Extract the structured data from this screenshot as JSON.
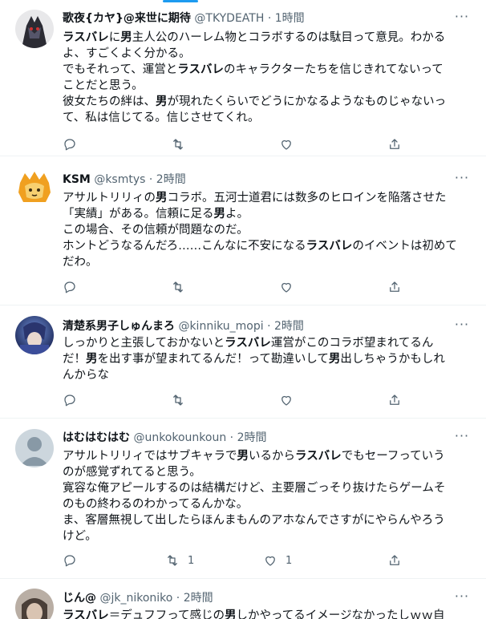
{
  "tweets": [
    {
      "name": "歌夜{カヤ}@来世に期待",
      "handle": "@TKYDEATH",
      "time": "1時間",
      "lines": [
        [
          {
            "t": "ラスバレ",
            "b": true
          },
          {
            "t": "に"
          },
          {
            "t": "男",
            "b": true
          },
          {
            "t": "主人公のハーレム物とコラボするのは駄目って意見。わかる"
          }
        ],
        [
          {
            "t": "よ、すごくよく分かる。"
          }
        ],
        [
          {
            "t": "でもそれって、運営と"
          },
          {
            "t": "ラスバレ",
            "b": true
          },
          {
            "t": "のキャラクターたちを信じきれてないって"
          }
        ],
        [
          {
            "t": "ことだと思う。"
          }
        ],
        [
          {
            "t": "彼女たちの絆は、"
          },
          {
            "t": "男",
            "b": true
          },
          {
            "t": "が現れたくらいでどうにかなるようなものじゃないっ"
          }
        ],
        [
          {
            "t": "て、私は信じてる。信じさせてくれ。"
          }
        ]
      ],
      "reply": "",
      "retweet": "",
      "like": ""
    },
    {
      "name": "KSM",
      "handle": "@ksmtys",
      "time": "2時間",
      "lines": [
        [
          {
            "t": "アサルトリリィの"
          },
          {
            "t": "男",
            "b": true
          },
          {
            "t": "コラボ。五河士道君には数多のヒロインを陥落させた"
          }
        ],
        [
          {
            "t": "「実績」がある。信頼に足る"
          },
          {
            "t": "男",
            "b": true
          },
          {
            "t": "よ。"
          }
        ],
        [
          {
            "t": "この場合、その信頼が問題なのだ。"
          }
        ],
        [
          {
            "t": "ホントどうなるんだろ……こんなに不安になる"
          },
          {
            "t": "ラスバレ",
            "b": true
          },
          {
            "t": "のイベントは初めて"
          }
        ],
        [
          {
            "t": "だわ。"
          }
        ]
      ],
      "reply": "",
      "retweet": "",
      "like": ""
    },
    {
      "name": "清楚系男子しゅんまろ",
      "handle": "@kinniku_mopi",
      "time": "2時間",
      "lines": [
        [
          {
            "t": "しっかりと主張しておかないと"
          },
          {
            "t": "ラスバレ",
            "b": true
          },
          {
            "t": "運営がこのコラボ望まれてるん"
          }
        ],
        [
          {
            "t": "だ！"
          },
          {
            "t": "男",
            "b": true
          },
          {
            "t": "を出す事が望まれてるんだ！って勘違いして"
          },
          {
            "t": "男",
            "b": true
          },
          {
            "t": "出しちゃうかもしれ"
          }
        ],
        [
          {
            "t": "んからな"
          }
        ]
      ],
      "reply": "",
      "retweet": "",
      "like": ""
    },
    {
      "name": "はむはむはむ",
      "handle": "@unkokounkoun",
      "time": "2時間",
      "lines": [
        [
          {
            "t": "アサルトリリィではサブキャラで"
          },
          {
            "t": "男",
            "b": true
          },
          {
            "t": "いるから"
          },
          {
            "t": "ラスバレ",
            "b": true
          },
          {
            "t": "でもセーフっていう"
          }
        ],
        [
          {
            "t": "のが感覚ずれてると思う。"
          }
        ],
        [
          {
            "t": "寛容な俺アピールするのは結構だけど、主要層ごっそり抜けたらゲームそ"
          }
        ],
        [
          {
            "t": "のもの終わるのわかってるんかな。"
          }
        ],
        [
          {
            "t": "ま、客層無視して出したらほんまもんのアホなんでさすがにやらんやろう"
          }
        ],
        [
          {
            "t": "けど。"
          }
        ]
      ],
      "reply": "",
      "retweet": "1",
      "like": "1"
    },
    {
      "name": "じん@",
      "handle": "@jk_nikoniko",
      "time": "2時間",
      "lines": [
        [
          {
            "t": "ラスバレ",
            "b": true
          },
          {
            "t": "＝デュフフって感じの"
          },
          {
            "t": "男",
            "b": true
          },
          {
            "t": "しかやってるイメージなかったしｗｗ自"
          }
        ]
      ],
      "reply": "",
      "retweet": "",
      "like": ""
    }
  ],
  "more_label": "···",
  "colors": {
    "accent": "#1d9bf0",
    "text": "#0f1419",
    "muted": "#536471",
    "divider": "#eff3f4"
  },
  "icons": [
    "reply-icon",
    "retweet-icon",
    "like-icon",
    "share-icon",
    "more-icon"
  ]
}
